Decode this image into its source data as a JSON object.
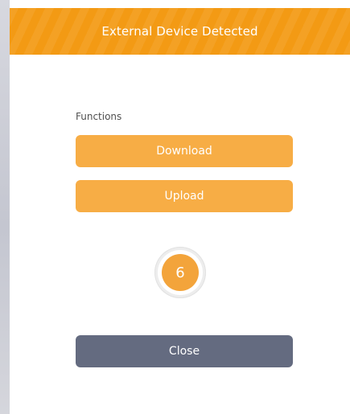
{
  "dialog": {
    "title": "External Device Detected",
    "section_label": "Functions",
    "buttons": {
      "download": "Download",
      "upload": "Upload",
      "close": "Close"
    },
    "countdown": "6"
  },
  "colors": {
    "header": "#f39a14",
    "function_button": "#f7ad45",
    "countdown": "#f3a43b",
    "close_button": "#646b80"
  }
}
